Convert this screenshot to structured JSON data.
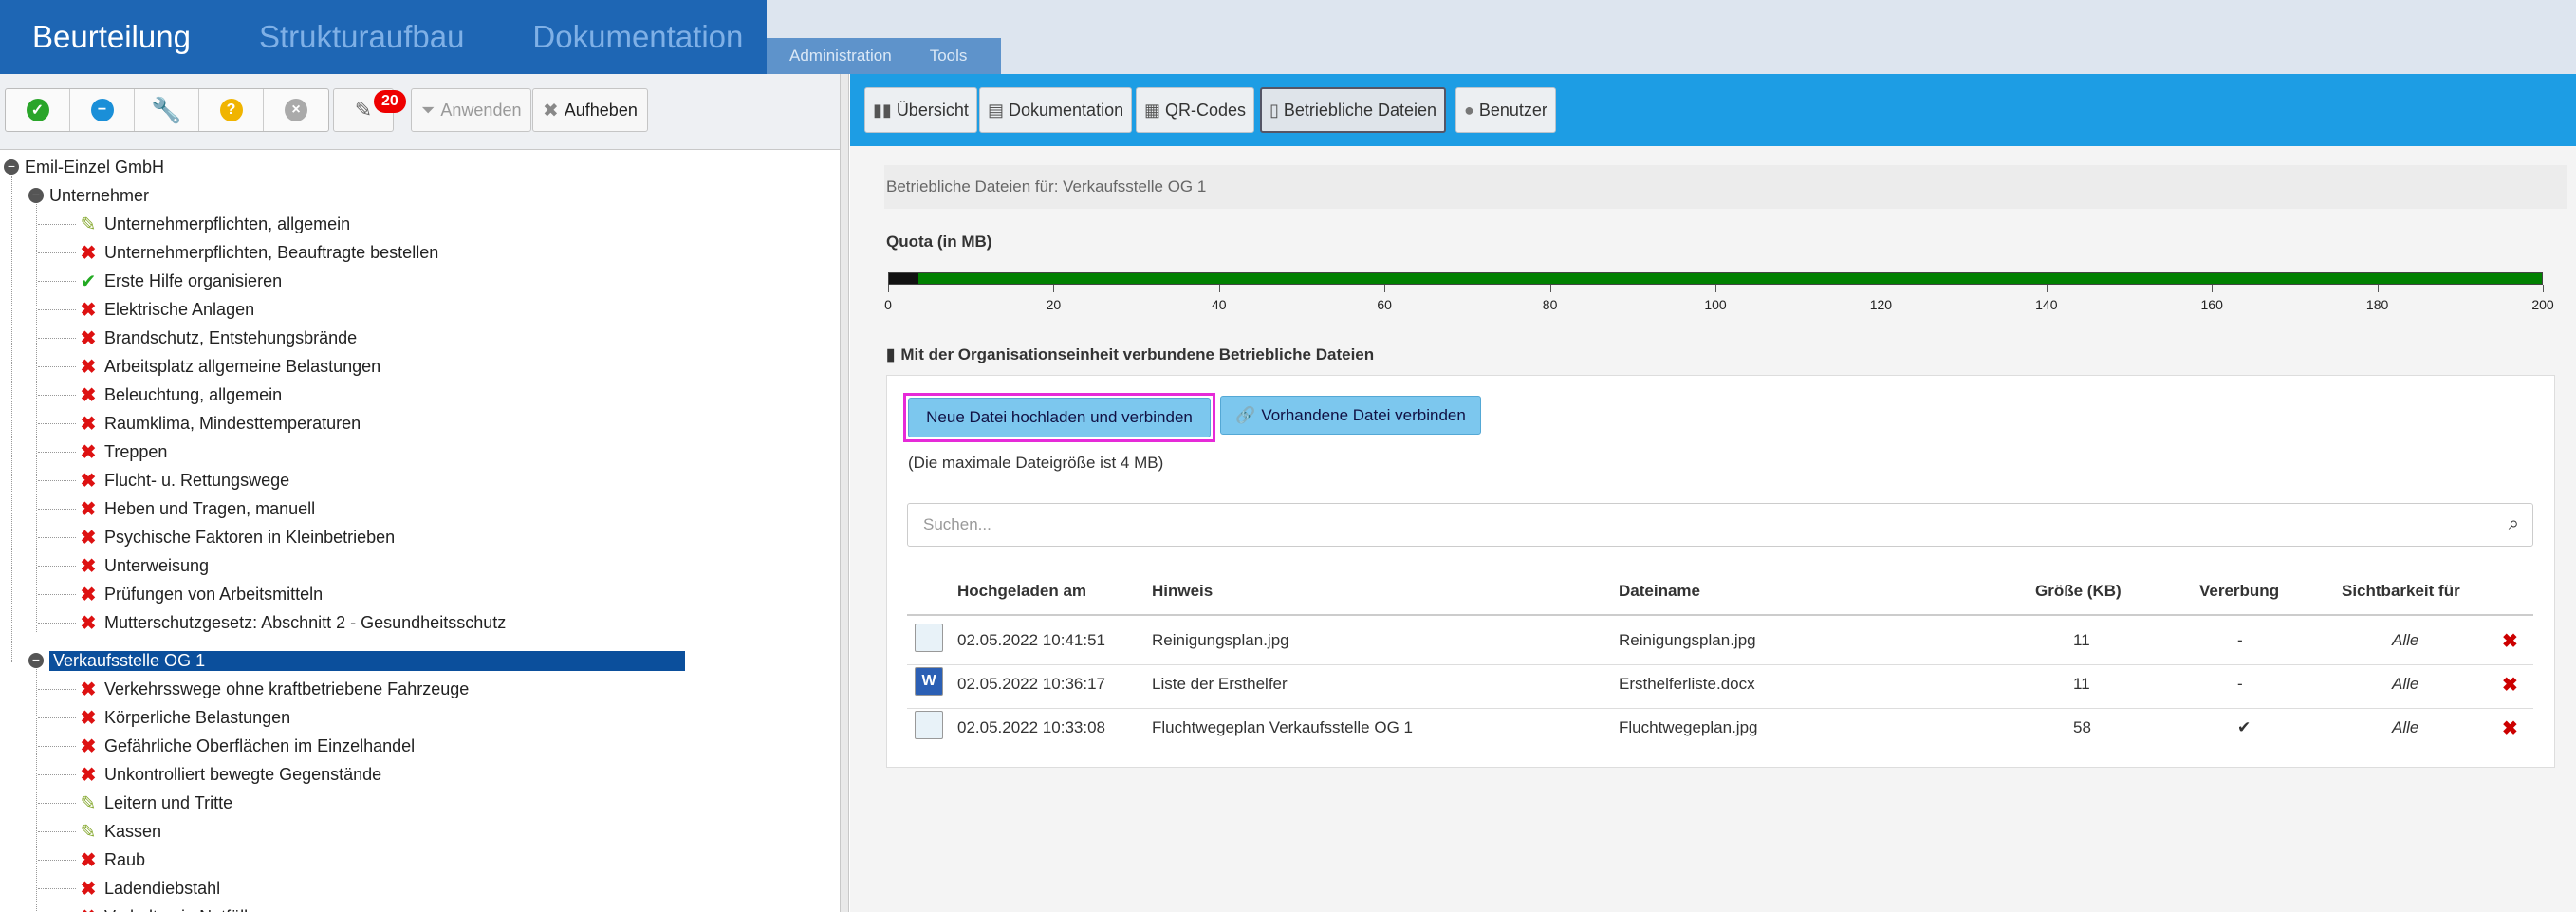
{
  "mainnav": {
    "items": [
      "Beurteilung",
      "Strukturaufbau",
      "Dokumentation"
    ]
  },
  "subnav": {
    "items": [
      "Administration",
      "Tools"
    ]
  },
  "toolbar": {
    "badge": "20",
    "apply": "Anwenden",
    "cancel": "Aufheben"
  },
  "tree": {
    "root": "Emil-Einzel GmbH",
    "group1": "Unternehmer",
    "group1_items": [
      {
        "label": "Unternehmerpflichten, allgemein",
        "status": "edit"
      },
      {
        "label": "Unternehmerpflichten, Beauftragte bestellen",
        "status": "x"
      },
      {
        "label": "Erste Hilfe organisieren",
        "status": "ok"
      },
      {
        "label": "Elektrische Anlagen",
        "status": "x"
      },
      {
        "label": "Brandschutz, Entstehungsbrände",
        "status": "x"
      },
      {
        "label": "Arbeitsplatz allgemeine Belastungen",
        "status": "x"
      },
      {
        "label": "Beleuchtung, allgemein",
        "status": "x"
      },
      {
        "label": "Raumklima, Mindesttemperaturen",
        "status": "x"
      },
      {
        "label": "Treppen",
        "status": "x"
      },
      {
        "label": "Flucht- u. Rettungswege",
        "status": "x"
      },
      {
        "label": "Heben und Tragen, manuell",
        "status": "x"
      },
      {
        "label": "Psychische Faktoren in Kleinbetrieben",
        "status": "x"
      },
      {
        "label": "Unterweisung",
        "status": "x"
      },
      {
        "label": "Prüfungen von Arbeitsmitteln",
        "status": "x"
      },
      {
        "label": "Mutterschutzgesetz: Abschnitt 2 - Gesundheitsschutz",
        "status": "x"
      }
    ],
    "group2": "Verkaufsstelle OG 1",
    "group2_items": [
      {
        "label": "Verkehrsswege ohne kraftbetriebene Fahrzeuge",
        "status": "x"
      },
      {
        "label": "Körperliche Belastungen",
        "status": "x"
      },
      {
        "label": "Gefährliche Oberflächen im Einzelhandel",
        "status": "x"
      },
      {
        "label": "Unkontrolliert bewegte Gegenstände",
        "status": "x"
      },
      {
        "label": "Leitern und Tritte",
        "status": "edit"
      },
      {
        "label": "Kassen",
        "status": "edit"
      },
      {
        "label": "Raub",
        "status": "x"
      },
      {
        "label": "Ladendiebstahl",
        "status": "x"
      },
      {
        "label": "Verhalten in Notfällen",
        "status": "x"
      }
    ]
  },
  "tabs": [
    "Übersicht",
    "Dokumentation",
    "QR-Codes",
    "Betriebliche Dateien",
    "Benutzer"
  ],
  "breadcrumb": "Betriebliche Dateien für: Verkaufsstelle OG 1",
  "quota": {
    "label": "Quota (in MB)",
    "used_fraction": 0.018,
    "ticks": [
      "0",
      "20",
      "40",
      "60",
      "80",
      "100",
      "120",
      "140",
      "160",
      "180",
      "200"
    ]
  },
  "section_title": "Mit der Organisationseinheit verbundene Betriebliche Dateien",
  "upload_button": "Neue Datei hochladen und verbinden",
  "link_button": "Vorhandene Datei verbinden",
  "max_size": "(Die maximale Dateigröße ist 4 MB)",
  "search": {
    "placeholder": "Suchen..."
  },
  "table": {
    "headers": [
      "Hochgeladen am",
      "Hinweis",
      "Dateiname",
      "Größe (KB)",
      "Vererbung",
      "Sichtbarkeit für"
    ],
    "rows": [
      {
        "date": "02.05.2022 10:41:51",
        "note": "Reinigungsplan.jpg",
        "file": "Reinigungsplan.jpg",
        "size": "11",
        "inherit": "-",
        "visible": "Alle",
        "icon": "image-file-icon"
      },
      {
        "date": "02.05.2022 10:36:17",
        "note": "Liste der Ersthelfer",
        "file": "Ersthelferliste.docx",
        "size": "11",
        "inherit": "-",
        "visible": "Alle",
        "icon": "word-file-icon"
      },
      {
        "date": "02.05.2022 10:33:08",
        "note": "Fluchtwegeplan Verkaufsstelle OG 1",
        "file": "Fluchtwegeplan.jpg",
        "size": "58",
        "inherit": "✔",
        "visible": "Alle",
        "icon": "image-file-icon"
      }
    ]
  }
}
